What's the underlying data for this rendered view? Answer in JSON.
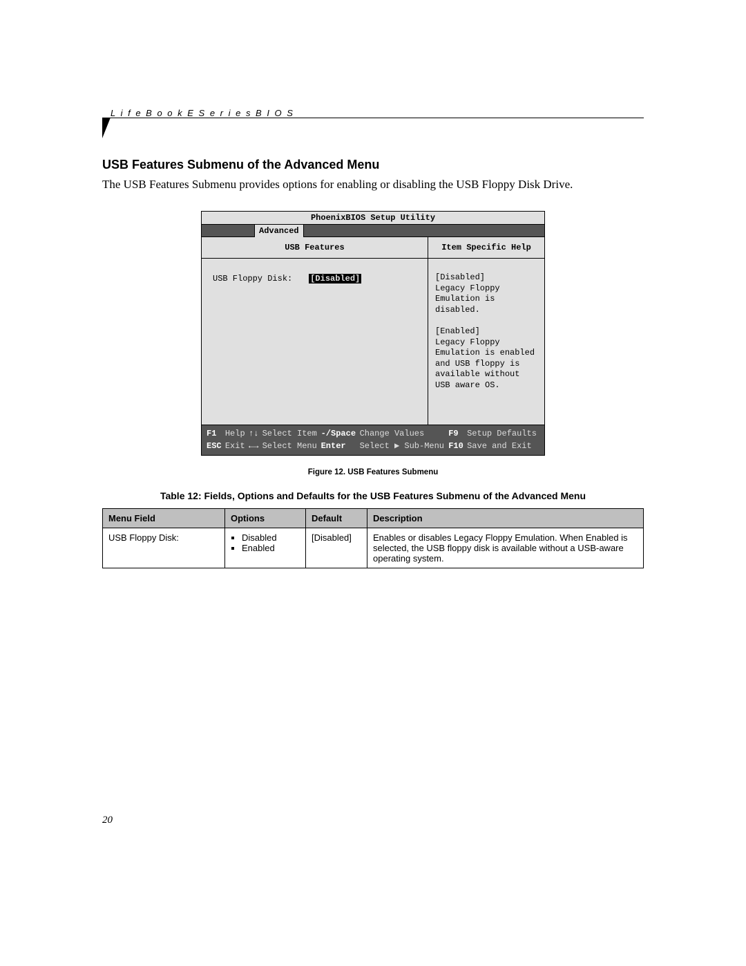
{
  "running_head": "L i f e B o o k   E   S e r i e s   B I O S",
  "section_heading": "USB Features Submenu of the Advanced Menu",
  "intro_paragraph": "The USB Features Submenu provides options for enabling or disabling the USB Floppy Disk Drive.",
  "bios": {
    "title": "PhoenixBIOS Setup Utility",
    "active_tab": "Advanced",
    "left_pane_title": "USB Features",
    "right_pane_title": "Item Specific Help",
    "setting_label": "USB Floppy Disk:",
    "setting_value": "[Disabled]",
    "help_text": "[Disabled]\nLegacy Floppy Emulation is disabled.\n\n[Enabled]\nLegacy Floppy Emulation is enabled and USB floppy is available without USB aware OS.",
    "footer": {
      "r1": {
        "k1": "F1",
        "a1": "Help",
        "k2": "↑↓",
        "a2": "Select Item",
        "k3": "-/Space",
        "a3": "Change Values",
        "k4": "F9",
        "a4": "Setup Defaults"
      },
      "r2": {
        "k1": "ESC",
        "a1": "Exit",
        "k2": "←→",
        "a2": "Select Menu",
        "k3": "Enter",
        "a3": "Select ▶ Sub-Menu",
        "k4": "F10",
        "a4": "Save and Exit"
      }
    }
  },
  "figure_caption": "Figure 12.  USB Features Submenu",
  "table_caption": "Table 12: Fields, Options and Defaults for the USB Features Submenu of the Advanced Menu",
  "table_headers": {
    "field": "Menu Field",
    "options": "Options",
    "default": "Default",
    "description": "Description"
  },
  "table_row": {
    "field": "USB Floppy Disk:",
    "option1": "Disabled",
    "option2": "Enabled",
    "default": "[Disabled]",
    "description": "Enables or disables Legacy Floppy Emulation. When Enabled is selected, the USB floppy disk is available without a USB-aware operating system."
  },
  "page_number": "20"
}
